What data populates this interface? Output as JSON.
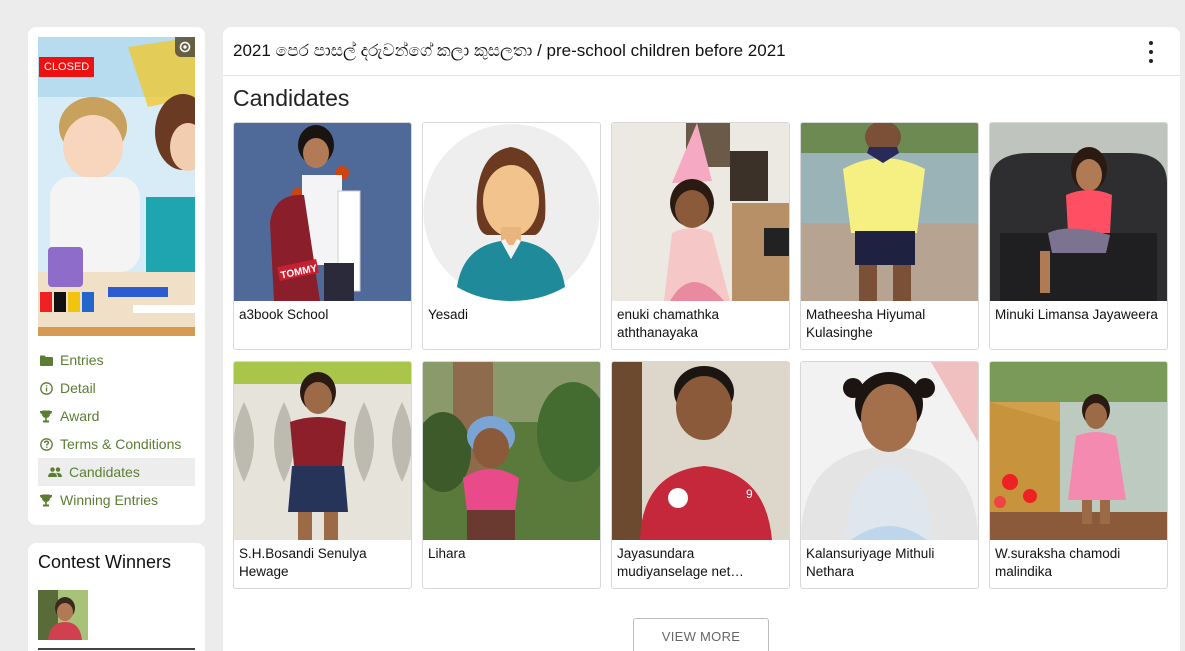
{
  "contest": {
    "status_badge": "CLOSED",
    "title": "2021 පෙර පාසල් දරුවන්ගේ කලා කුසලතා / pre-school children before 2021"
  },
  "sidebar": {
    "items": [
      {
        "label": "Entries",
        "icon": "folder-icon"
      },
      {
        "label": "Detail",
        "icon": "info-icon"
      },
      {
        "label": "Award",
        "icon": "trophy-icon"
      },
      {
        "label": "Terms & Conditions",
        "icon": "help-icon"
      },
      {
        "label": "Candidates",
        "icon": "people-icon",
        "active": true
      },
      {
        "label": "Winning Entries",
        "icon": "trophy-icon"
      }
    ]
  },
  "winners": {
    "title": "Contest Winners"
  },
  "main": {
    "section_title": "Candidates",
    "candidates": [
      {
        "name": "a3book School"
      },
      {
        "name": "Yesadi"
      },
      {
        "name": "enuki chamathka aththanayaka"
      },
      {
        "name": "Matheesha Hiyumal Kulasinghe"
      },
      {
        "name": "Minuki Limansa Jayaweera"
      },
      {
        "name": "S.H.Bosandi Senulya Hewage"
      },
      {
        "name": "Lihara"
      },
      {
        "name": "Jayasundara mudiyanselage net…"
      },
      {
        "name": "Kalansuriyage Mithuli Nethara"
      },
      {
        "name": "W.suraksha chamodi malindika"
      }
    ],
    "view_more_label": "VIEW MORE"
  },
  "colors": {
    "accent": "#5a7d32",
    "badge": "#ee1111"
  }
}
